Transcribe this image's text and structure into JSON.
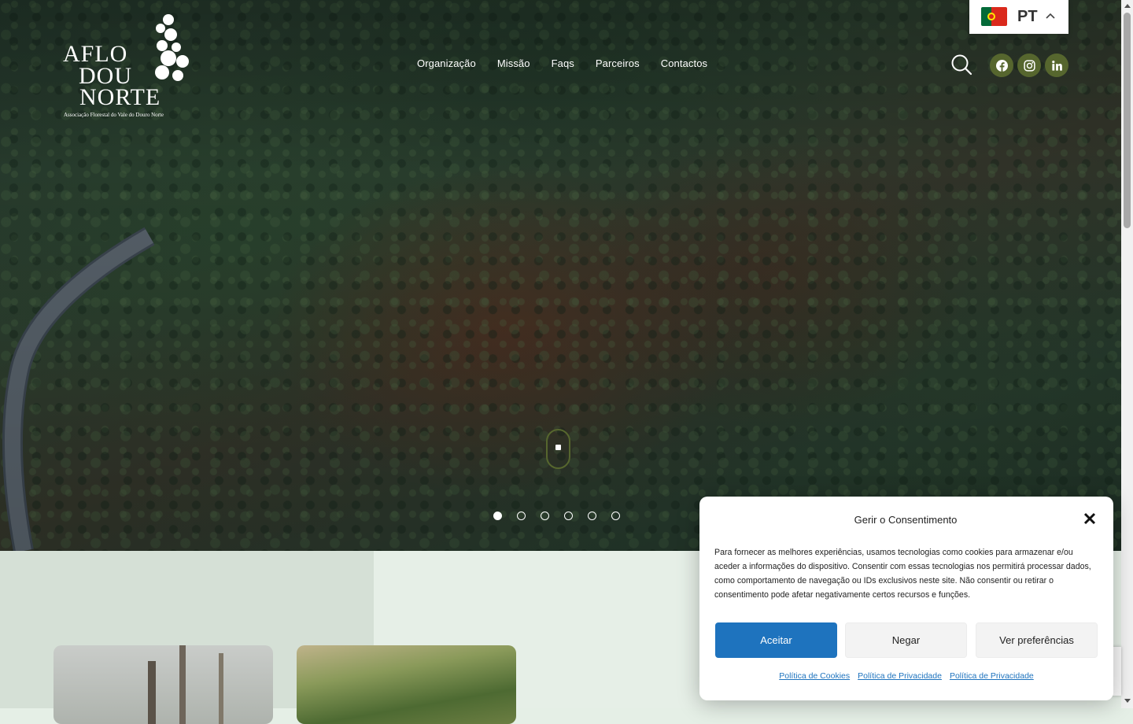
{
  "logo": {
    "line1": "AFLO",
    "line2": "DOU",
    "line3": "NORTE",
    "subtitle": "Associação Florestal do Vale do Douro Norte"
  },
  "nav": {
    "items": [
      {
        "label": "Organização"
      },
      {
        "label": "Missão"
      },
      {
        "label": "Faqs"
      },
      {
        "label": "Parceiros"
      },
      {
        "label": "Contactos"
      }
    ]
  },
  "language": {
    "code": "PT",
    "flag": "portugal-flag-icon"
  },
  "social": {
    "icons": [
      "facebook-icon",
      "instagram-icon",
      "linkedin-icon"
    ],
    "accent_color": "#56662e"
  },
  "slider": {
    "slide_count": 6,
    "active_index": 0
  },
  "consent": {
    "title": "Gerir o Consentimento",
    "text": "Para fornecer as melhores experiências, usamos tecnologias como cookies para armazenar e/ou aceder a informações do dispositivo. Consentir com essas tecnologias nos permitirá processar dados, como comportamento de navegação ou IDs exclusivos neste site. Não consentir ou retirar o consentimento pode afetar negativamente certos recursos e funções.",
    "accept_label": "Aceitar",
    "deny_label": "Negar",
    "preferences_label": "Ver preferências",
    "links": [
      {
        "label": "Política de Cookies"
      },
      {
        "label": "Política de Privacidade"
      },
      {
        "label": "Política de Privacidade"
      }
    ],
    "accept_color": "#1e73be"
  }
}
